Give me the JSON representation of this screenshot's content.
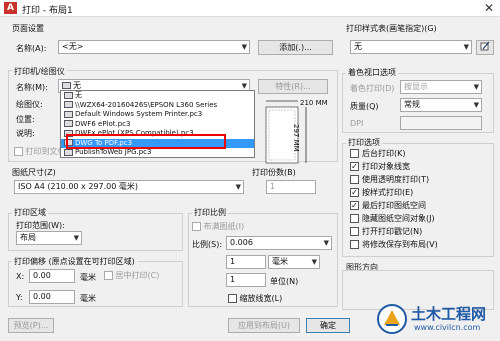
{
  "window": {
    "title": "打印 - 布局1",
    "icon": "A",
    "close": "✕"
  },
  "page_setup": {
    "group": "页面设置",
    "name_label": "名称(A):",
    "name_value": "<无>",
    "add_button": "添加(.)..."
  },
  "printer": {
    "group": "打印机/绘图仪",
    "name_label": "名称(M):",
    "name_value": "无",
    "properties_button": "特性(R)...",
    "plotter_label": "绘图仪:",
    "location_label": "位置:",
    "description_label": "说明:",
    "print_to_file": "打印到文件(F)"
  },
  "printer_dropdown": {
    "items": [
      "无",
      "\\\\WZX64-20160426S\\EPSON L360 Series",
      "Default Windows System Printer.pc3",
      "DWF6 ePlot.pc3",
      "DWFx ePlot (XPS Compatible).pc3",
      "DWG To PDF.pc3",
      "PublishToWeb JPG.pc3"
    ],
    "selected_index": 5
  },
  "preview": {
    "width_label": "210 MM",
    "height_label": "297 MM"
  },
  "paper_size": {
    "group": "图纸尺寸(Z)",
    "value": "ISO A4 (210.00 x 297.00 毫米)"
  },
  "copies": {
    "label": "打印份数(B)",
    "value": "1"
  },
  "plot_area": {
    "group": "打印区域",
    "range_label": "打印范围(W):",
    "range_value": "布局"
  },
  "plot_offset": {
    "group": "打印偏移 (原点设置在可打印区域)",
    "x_label": "X:",
    "x_value": "0.00",
    "x_unit": "毫米",
    "center_label": "居中打印(C)",
    "y_label": "Y:",
    "y_value": "0.00",
    "y_unit": "毫米"
  },
  "plot_scale": {
    "group": "打印比例",
    "fit_label": "布满图纸(I)",
    "scale_label": "比例(S):",
    "scale_value": "0.006",
    "value1": "1",
    "unit1": "毫米",
    "value2": "1",
    "unit2": "单位(N)",
    "lineweights_label": "缩放线宽(L)"
  },
  "plot_style": {
    "group": "打印样式表(画笔指定)(G)",
    "value": "无"
  },
  "shaded_viewport": {
    "group": "着色视口选项",
    "shade_label": "着色打印(D)",
    "shade_value": "按显示",
    "quality_label": "质量(Q)",
    "quality_value": "常规",
    "dpi_label": "DPI"
  },
  "plot_options": {
    "group": "打印选项",
    "items": [
      {
        "label": "后台打印(K)",
        "checked": false
      },
      {
        "label": "打印对象线宽",
        "checked": true
      },
      {
        "label": "使用透明度打印(T)",
        "checked": false
      },
      {
        "label": "按样式打印(E)",
        "checked": true
      },
      {
        "label": "最后打印图纸空间",
        "checked": true
      },
      {
        "label": "隐藏图纸空间对象(J)",
        "checked": false
      },
      {
        "label": "打开打印戳记(N)",
        "checked": false
      },
      {
        "label": "将修改保存到布局(V)",
        "checked": false
      }
    ]
  },
  "orientation": {
    "group": "图形方向"
  },
  "footer": {
    "preview_button": "预览(P)...",
    "apply_button": "应用到布局(U)",
    "ok_button": "确定"
  },
  "watermark": {
    "title": "土木工程网",
    "url": "www.civilcn.com"
  },
  "colors": {
    "selection": "#3399ff",
    "highlight_box": "#e00000",
    "watermark_blue": "#1f5aa6"
  }
}
